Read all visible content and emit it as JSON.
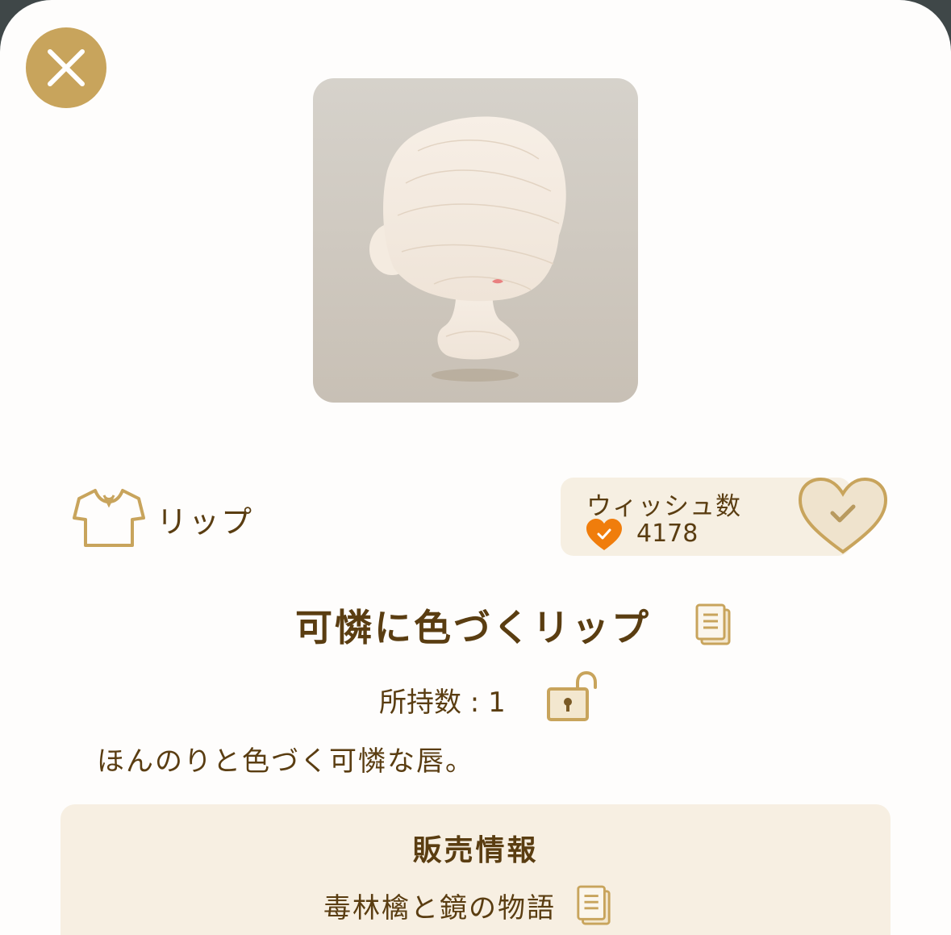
{
  "header": {
    "close_icon": "close-icon"
  },
  "preview": {
    "image": "lip-item-preview"
  },
  "category": {
    "icon": "shirt-icon",
    "label": "リップ"
  },
  "wish": {
    "label": "ウィッシュ数",
    "count": "4178",
    "small_icon": "heart-check-icon",
    "button_icon": "heart-check-icon"
  },
  "item": {
    "name": "可憐に色づくリップ",
    "copy_icon": "copy-icon",
    "owned_text": "所持数 : 1",
    "lock_icon": "unlock-icon",
    "description": "ほんのりと色づく可憐な唇。"
  },
  "sales": {
    "title": "販売情報",
    "source": "毒林檎と鏡の物語",
    "copy_icon": "copy-icon"
  },
  "colors": {
    "accent": "#c8a45c",
    "text": "#5a3d11",
    "panel": "#f6efe2",
    "heart_orange": "#f07d0c"
  }
}
